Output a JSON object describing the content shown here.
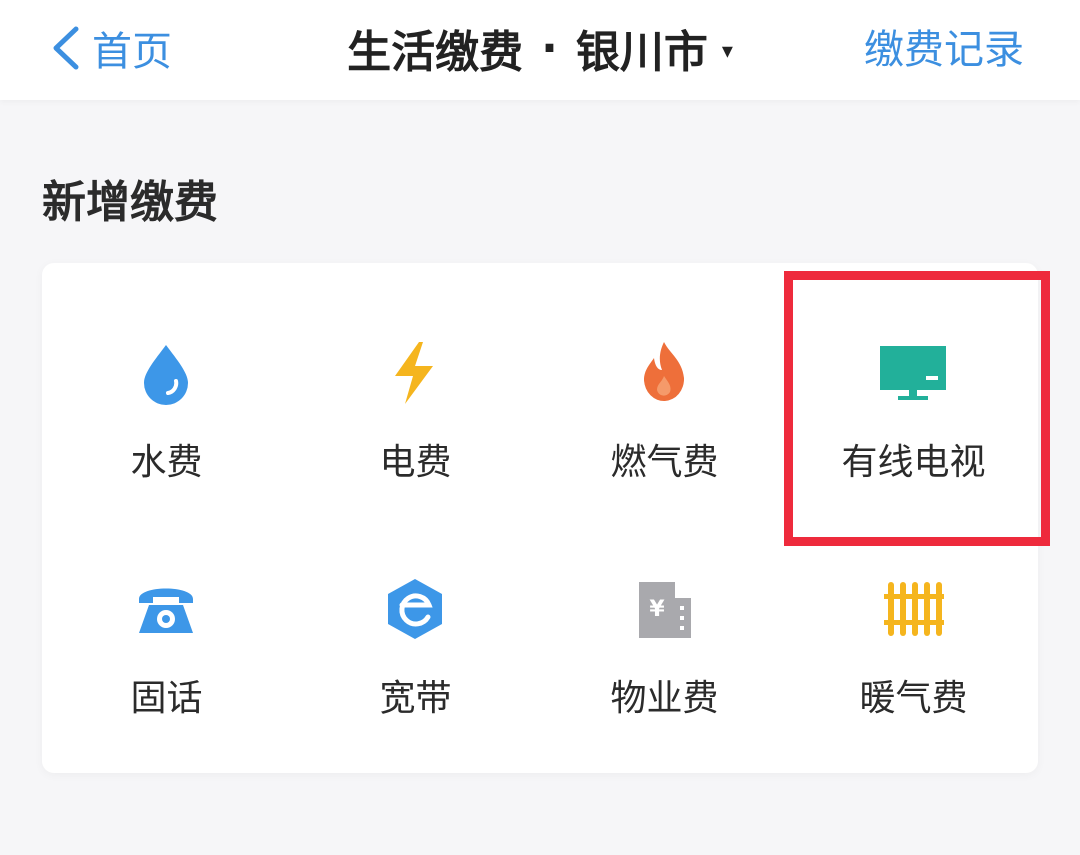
{
  "nav": {
    "back_label": "首页",
    "title": "生活缴费",
    "title_separator": "·",
    "city": "银川市",
    "caret": "▾",
    "records_label": "缴费记录"
  },
  "section": {
    "title": "新增缴费"
  },
  "items": [
    {
      "label": "水费",
      "icon": "water-drop-icon",
      "color": "#3d97e8"
    },
    {
      "label": "电费",
      "icon": "lightning-icon",
      "color": "#f5b51e"
    },
    {
      "label": "燃气费",
      "icon": "flame-icon",
      "color": "#ee6f3a"
    },
    {
      "label": "有线电视",
      "icon": "tv-icon",
      "color": "#22b09a"
    },
    {
      "label": "固话",
      "icon": "telephone-icon",
      "color": "#3d97e8"
    },
    {
      "label": "宽带",
      "icon": "broadband-e-icon",
      "color": "#3d97e8"
    },
    {
      "label": "物业费",
      "icon": "building-yen-icon",
      "color": "#a9a9ad"
    },
    {
      "label": "暖气费",
      "icon": "radiator-icon",
      "color": "#f5b51e"
    }
  ],
  "highlight_color": "#ee2a3c"
}
